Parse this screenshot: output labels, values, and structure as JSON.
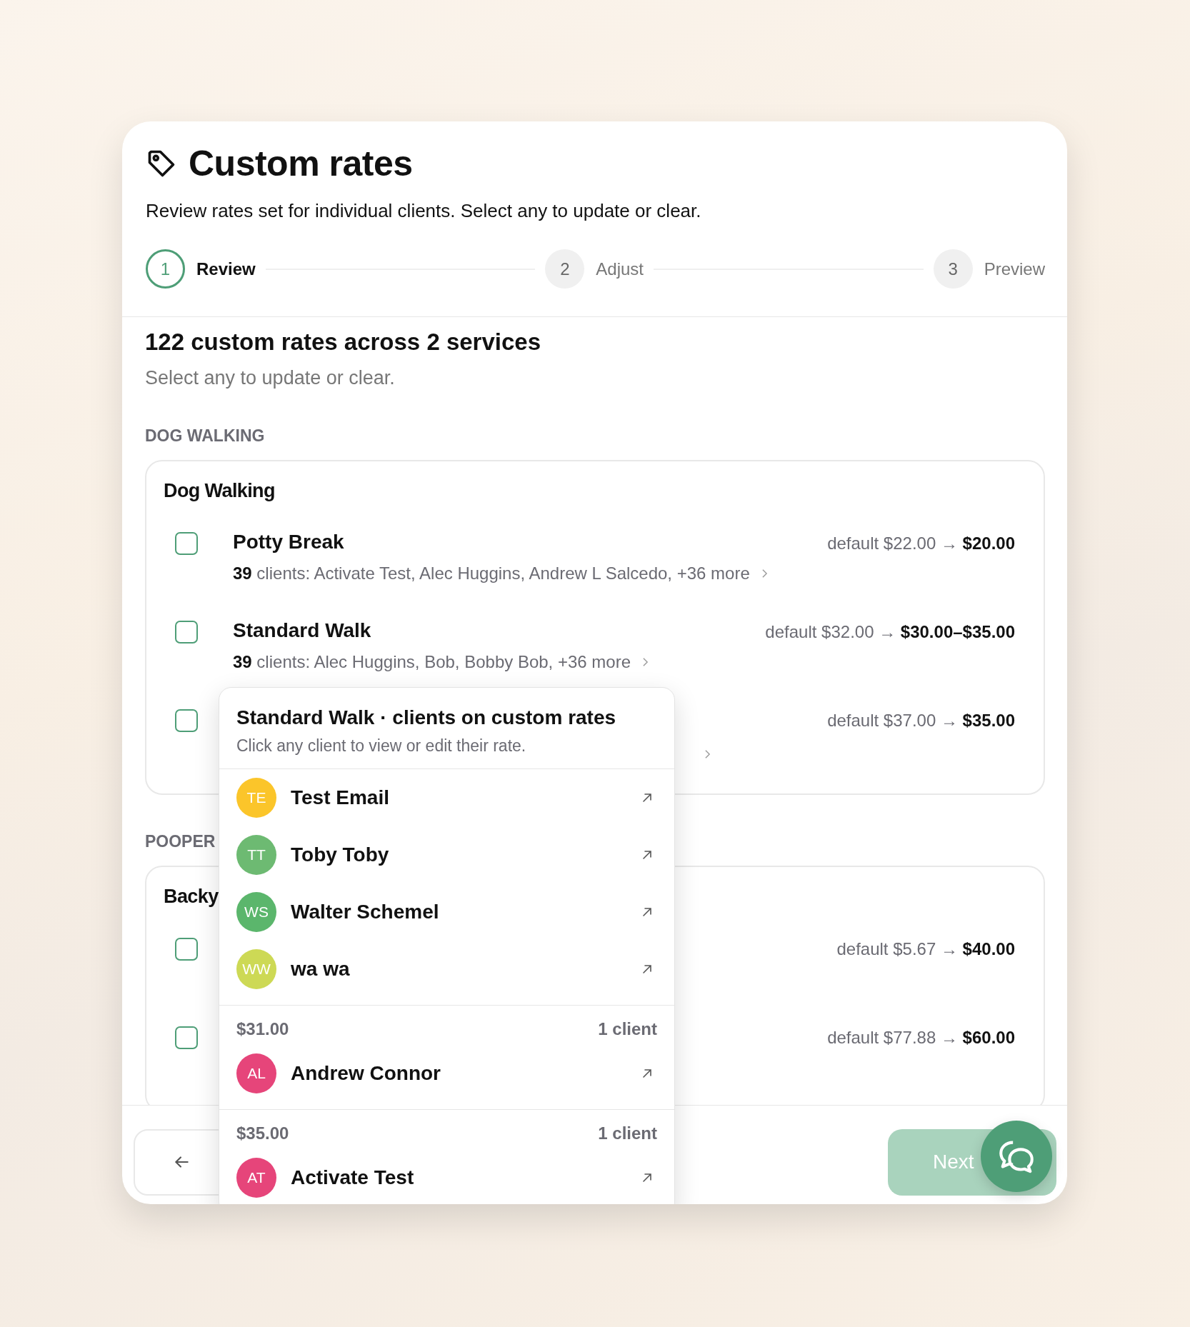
{
  "header": {
    "title": "Custom rates",
    "subtitle": "Review rates set for individual clients. Select any to update or clear."
  },
  "steps": [
    {
      "number": "1",
      "label": "Review",
      "selected": true
    },
    {
      "number": "2",
      "label": "Adjust",
      "selected": false
    },
    {
      "number": "3",
      "label": "Preview",
      "selected": false
    }
  ],
  "summary": {
    "title": "122 custom rates across 2 services",
    "subtitle": "Select any to update or clear."
  },
  "sections": [
    {
      "label": "DOG WALKING",
      "group_title": "Dog Walking",
      "rates": [
        {
          "name": "Potty Break",
          "clients": "**39** clients: Activate Test, Alec Huggins, Andrew L Salcedo, +36 more",
          "price": "default $22.00 → **$20.00**",
          "checked": false
        },
        {
          "name": "Standard Walk",
          "clients": "**39** clients: Alec Huggins, Bob, Bobby Bob, +36 more",
          "price": "default $32.00 → **$30.00–$35.00**",
          "checked": false
        },
        {
          "price": "default $37.00 → **$35.00**",
          "checked": false,
          "kind": "link_only"
        }
      ]
    },
    {
      "label": "POOPER",
      "group_title": "Backy",
      "rates": [
        {
          "price": "default $5.67 → **$40.00**",
          "checked": false
        },
        {
          "price": "default $77.88 → **$60.00**",
          "checked": false
        }
      ]
    }
  ],
  "popover": {
    "title": "Standard Walk · clients on custom rates",
    "subtitle": "Click any client to view or edit their rate.",
    "groups": [
      {
        "clients": [
          {
            "initials": "TE",
            "name": "Test Email",
            "color": "#fbc52a"
          },
          {
            "initials": "TT",
            "name": "Toby Toby",
            "color": "#6dba72"
          },
          {
            "initials": "WS",
            "name": "Walter Schemel",
            "color": "#5bb66c"
          },
          {
            "initials": "WW",
            "name": "wa wa",
            "color": "#cdd955"
          }
        ]
      },
      {
        "price": "$31.00",
        "count": "1 client",
        "clients": [
          {
            "initials": "AL",
            "name": "Andrew Connor",
            "color": "#e6457a"
          }
        ]
      },
      {
        "price": "$35.00",
        "count": "1 client",
        "clients": [
          {
            "initials": "AT",
            "name": "Activate Test",
            "color": "#e6457a"
          }
        ]
      }
    ]
  },
  "footer": {
    "next_label": "Next"
  }
}
